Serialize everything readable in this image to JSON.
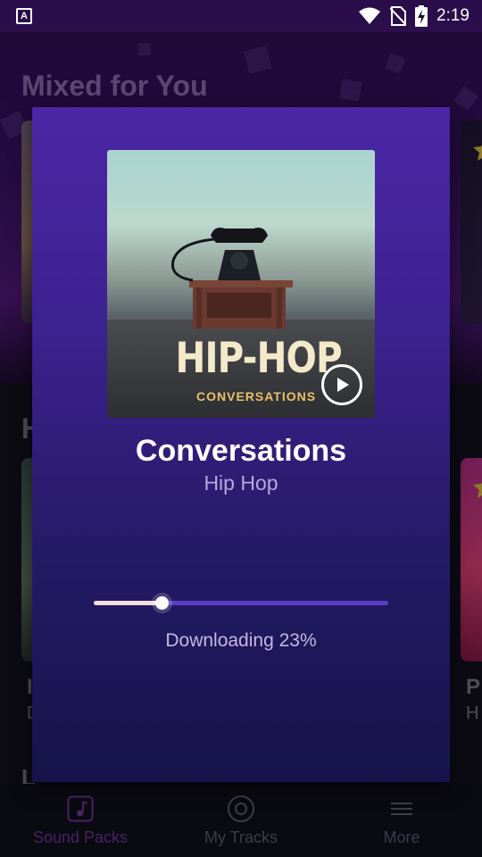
{
  "status_bar": {
    "app_badge": "A",
    "time": "2:19",
    "icons": [
      "wifi-icon",
      "no-sim-icon",
      "battery-charging-icon"
    ]
  },
  "background": {
    "section_title": "Mixed for You",
    "row2_peek_letter": "H",
    "card_left_peek_title": "I",
    "card_left_peek_subtitle": "D",
    "card_right_peek_title": "P",
    "card_right_peek_subtitle": "H",
    "row3_peek_letter": "L"
  },
  "modal": {
    "album_art_title": "HIP-HOP",
    "album_art_subtitle": "CONVERSATIONS",
    "track_title": "Conversations",
    "track_genre": "Hip Hop",
    "download_progress": 0.23,
    "download_status": "Downloading 23%",
    "colors": {
      "progress_fill": "#f4dede",
      "progress_track": "#5b3ec6",
      "accent": "#4c26a6"
    }
  },
  "bottom_nav": {
    "items": [
      {
        "label": "Sound Packs",
        "icon": "music-note-icon",
        "active": true
      },
      {
        "label": "My Tracks",
        "icon": "disc-icon",
        "active": false
      },
      {
        "label": "More",
        "icon": "menu-icon",
        "active": false
      }
    ]
  }
}
